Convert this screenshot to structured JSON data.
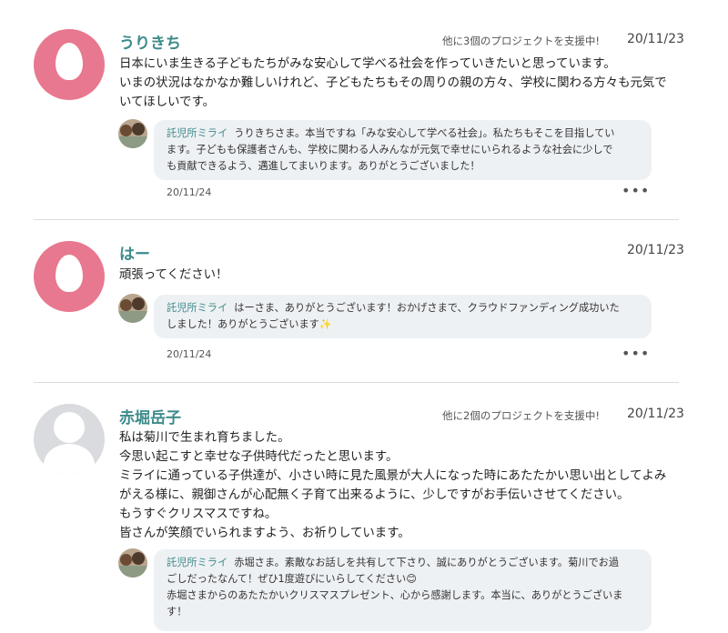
{
  "comments": [
    {
      "name": "うりきち",
      "backed": "他に3個のプロジェクトを支援中!",
      "date": "20/11/23",
      "lines": [
        "日本にいま生きる子どもたちがみな安心して学べる社会を作っていきたいと思っています。",
        "いまの状況はなかなか難しいけれど、子どもたちもその周りの親の方々、学校に関わる方々も元気で",
        "いてほしいです。"
      ],
      "reply": {
        "name": "託児所ミライ",
        "lines": [
          "うりきちさま。本当ですね「みな安心して学べる社会」。私たちもそこを目指してい",
          "ます。子どもも保護者さんも、学校に関わる人みんなが元気で幸せにいられるような社会に少しで",
          "も貢献できるよう、邁進してまいります。ありがとうございました！"
        ],
        "date": "20/11/24"
      }
    },
    {
      "name": "はー",
      "backed": "",
      "date": "20/11/23",
      "lines": [
        "頑張ってください！"
      ],
      "reply": {
        "name": "託児所ミライ",
        "lines": [
          "はーさま、ありがとうございます！おかげさまで、クラウドファンディング成功いた",
          "しました！ありがとうございます✨"
        ],
        "date": "20/11/24"
      }
    },
    {
      "name": "赤堀岳子",
      "backed": "他に2個のプロジェクトを支援中!",
      "date": "20/11/23",
      "lines": [
        "私は菊川で生まれ育ちました。",
        "今思い起こすと幸せな子供時代だったと思います。",
        "ミライに通っている子供達が、小さい時に見た風景が大人になった時にあたたかい思い出としてよみ",
        "がえる様に、親御さんが心配無く子育て出来るように、少しですがお手伝いさせてください。",
        "もうすぐクリスマスですね。",
        "皆さんが笑顔でいられますよう、お祈りしています。"
      ],
      "reply": {
        "name": "託児所ミライ",
        "lines": [
          "赤堀さま。素敵なお話しを共有して下さり、誠にありがとうございます。菊川でお過",
          "ごしだったなんて！ぜひ1度遊びにいらしてください😊",
          "赤堀さまからのあたたかいクリスマスプレゼント、心から感謝します。本当に、ありがとうございま",
          "す！"
        ]
      }
    }
  ],
  "more_icon": "ellipsis-icon"
}
